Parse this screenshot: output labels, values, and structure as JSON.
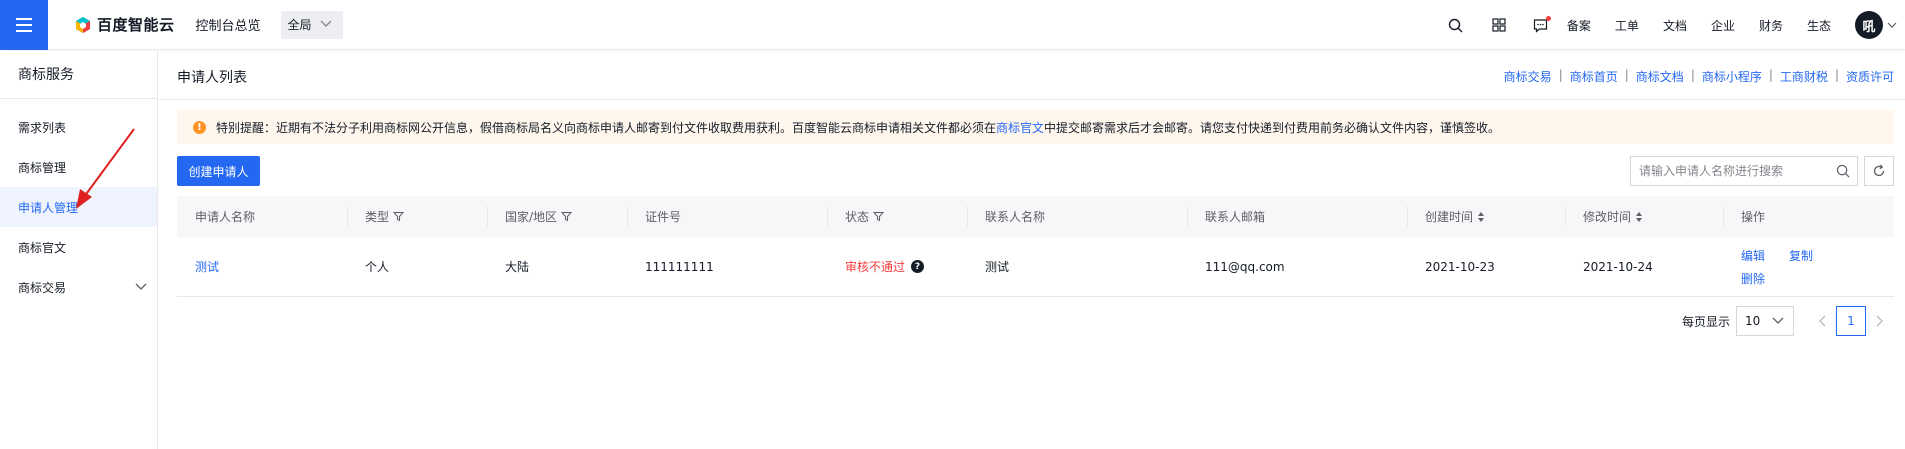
{
  "header": {
    "brand": "百度智能云",
    "console_link": "控制台总览",
    "region": "全局",
    "nav": [
      "备案",
      "工单",
      "文档",
      "企业",
      "财务",
      "生态"
    ],
    "avatar_text": "吼"
  },
  "sidebar": {
    "title": "商标服务",
    "items": [
      {
        "label": "需求列表"
      },
      {
        "label": "商标管理"
      },
      {
        "label": "申请人管理"
      },
      {
        "label": "商标官文"
      },
      {
        "label": "商标交易"
      }
    ]
  },
  "main": {
    "title": "申请人列表",
    "quick_links": [
      "商标交易",
      "商标首页",
      "商标文档",
      "商标小程序",
      "工商财税",
      "资质许可"
    ],
    "notice": {
      "prefix": "特别提醒：近期有不法分子利用商标网公开信息，假借商标局名义向商标申请人邮寄到付文件收取费用获利。百度智能云商标申请相关文件都必须在",
      "link": "商标官文",
      "suffix": "中提交邮寄需求后才会邮寄。请您支付快递到付费用前务必确认文件内容，谨慎签收。"
    },
    "create_button": "创建申请人",
    "search_placeholder": "请输入申请人名称进行搜索"
  },
  "table": {
    "columns": [
      "申请人名称",
      "类型",
      "国家/地区",
      "证件号",
      "状态",
      "联系人名称",
      "联系人邮箱",
      "创建时间",
      "修改时间",
      "操作"
    ],
    "rows": [
      {
        "name": "测试",
        "type": "个人",
        "region": "大陆",
        "id_number": "111111111",
        "status": "审核不通过",
        "contact_name": "测试",
        "contact_email": "111@qq.com",
        "created": "2021-10-23",
        "modified": "2021-10-24",
        "actions": [
          "编辑",
          "复制",
          "删除"
        ]
      }
    ]
  },
  "pagination": {
    "page_size_label": "每页显示",
    "page_size": "10",
    "current_page": "1"
  },
  "colors": {
    "primary": "#2468f2",
    "error": "#f33e3e",
    "warning": "#ff9326"
  }
}
